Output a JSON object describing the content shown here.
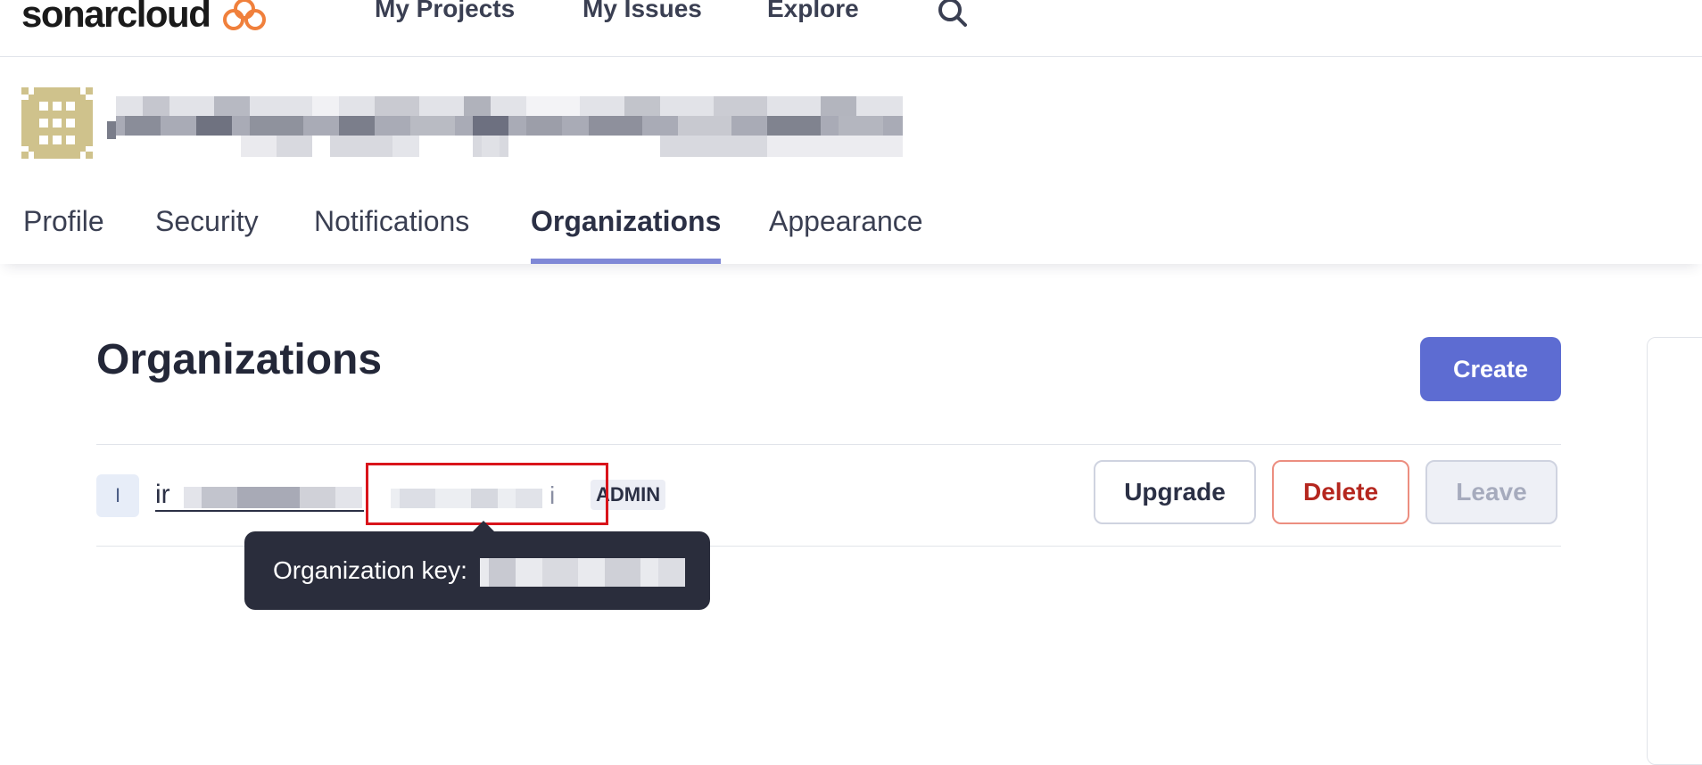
{
  "topnav": {
    "brand": "sonarcloud",
    "links": [
      "My Projects",
      "My Issues",
      "Explore"
    ],
    "search_icon": "search-icon"
  },
  "account": {
    "tabs": [
      "Profile",
      "Security",
      "Notifications",
      "Organizations",
      "Appearance"
    ],
    "active_tab": "Organizations"
  },
  "main": {
    "title": "Organizations",
    "create_label": "Create",
    "org": {
      "avatar_letter": "I",
      "name_visible_start": "ir",
      "key_visible_tail": "i",
      "badge": "ADMIN",
      "buttons": {
        "upgrade": "Upgrade",
        "delete": "Delete",
        "leave": "Leave"
      }
    },
    "tooltip": {
      "label": "Organization key:"
    }
  },
  "colors": {
    "accent": "#5d6cd2",
    "tab_underline": "#7f88d6",
    "delete": "#b5271f",
    "tooltip_bg": "#2a2d3c",
    "highlight": "#d9141b",
    "avatar_gold": "#cfc28c"
  }
}
